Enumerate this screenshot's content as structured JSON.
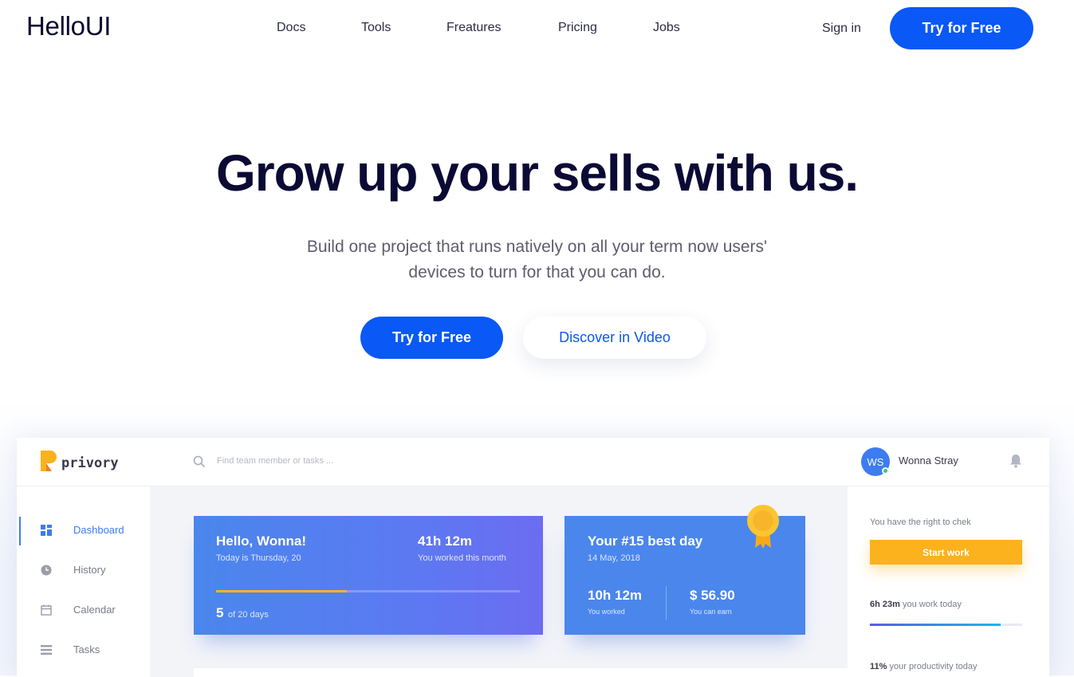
{
  "nav": {
    "logo": "HelloUI",
    "links": [
      "Docs",
      "Tools",
      "Freatures",
      "Pricing",
      "Jobs"
    ],
    "sign_in": "Sign in",
    "cta": "Try for Free"
  },
  "hero": {
    "title": "Grow up your sells with us.",
    "subtitle_line1": "Build one project that runs natively on all your term now users'",
    "subtitle_line2": "devices to turn for that you can do.",
    "cta_primary": "Try for Free",
    "cta_secondary": "Discover in Video"
  },
  "dashboard": {
    "brand": "privory",
    "search_placeholder": "Find team member or tasks ...",
    "user_initials": "WS",
    "user_name": "Wonna Stray",
    "sidebar": [
      {
        "label": "Dashboard",
        "icon": "dashboard-icon"
      },
      {
        "label": "History",
        "icon": "clock-icon"
      },
      {
        "label": "Calendar",
        "icon": "calendar-icon"
      },
      {
        "label": "Tasks",
        "icon": "tasks-icon"
      }
    ],
    "card1": {
      "greeting": "Hello, Wonna!",
      "date": "Today is Thursday, 20",
      "hours": "41h 12m",
      "hours_label": "You worked this month",
      "days_value": "5",
      "days_label": "of 20 days",
      "progress": 0.43
    },
    "card2": {
      "title": "Your #15 best day",
      "date": "14 May, 2018",
      "worked": "10h 12m",
      "worked_label": "You worked",
      "earn": "$ 56.90",
      "earn_label": "You can earn"
    },
    "right_panel": {
      "check_text": "You have the right to chek",
      "start_button": "Start work",
      "today_value": "6h 23m",
      "today_label": "you work today",
      "today_progress": 0.86,
      "productivity_value": "11%",
      "productivity_label": "your productivity today"
    }
  },
  "colors": {
    "primary": "#0a58f5",
    "card_blue": "#4a86ec",
    "accent_yellow": "#fbb21c"
  }
}
